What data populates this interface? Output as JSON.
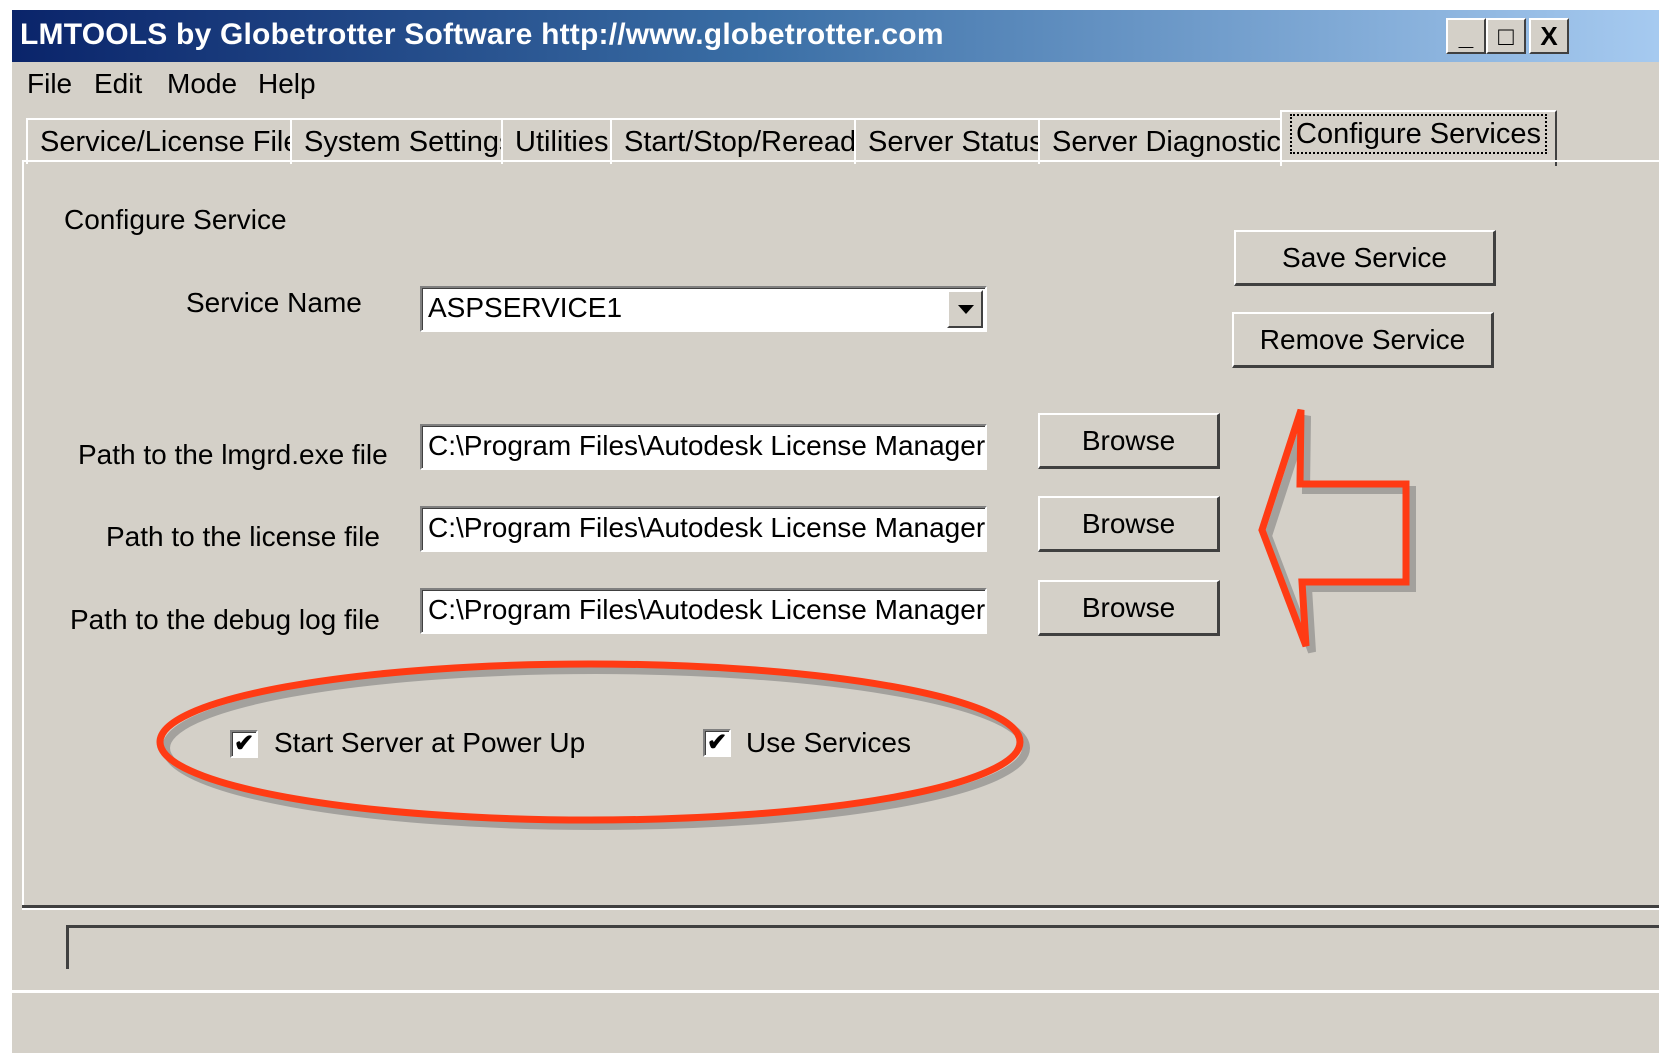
{
  "window": {
    "title": "LMTOOLS by Globetrotter Software http://www.globetrotter.com",
    "controls": {
      "minimize": "_",
      "maximize": "□",
      "close": "X"
    }
  },
  "menu": [
    "File",
    "Edit",
    "Mode",
    "Help"
  ],
  "tabs": [
    {
      "label": "Service/License File"
    },
    {
      "label": "System Settings"
    },
    {
      "label": "Utilities"
    },
    {
      "label": "Start/Stop/Reread"
    },
    {
      "label": "Server Status"
    },
    {
      "label": "Server Diagnostics"
    },
    {
      "label": "Configure Services",
      "active": true
    }
  ],
  "configure": {
    "section_label": "Configure Service",
    "service_name_label": "Service Name",
    "service_name_value": "ASPSERVICE1",
    "save_button": "Save Service",
    "remove_button": "Remove Service",
    "lmgrd_label": "Path to the lmgrd.exe file",
    "lmgrd_value": "C:\\Program Files\\Autodesk License Manager\\lm",
    "license_label": "Path to the license file",
    "license_value": "C:\\Program Files\\Autodesk License Manager\\Li",
    "debug_label": "Path to the debug log file",
    "debug_value": "C:\\Program Files\\Autodesk License Manager\\Li",
    "browse_label": "Browse",
    "start_at_power_up_label": "Start Server at Power Up",
    "start_at_power_up_checked": true,
    "use_services_label": "Use Services",
    "use_services_checked": true,
    "check_mark": "✔"
  },
  "annotations": {
    "color": "#ff3b14"
  }
}
